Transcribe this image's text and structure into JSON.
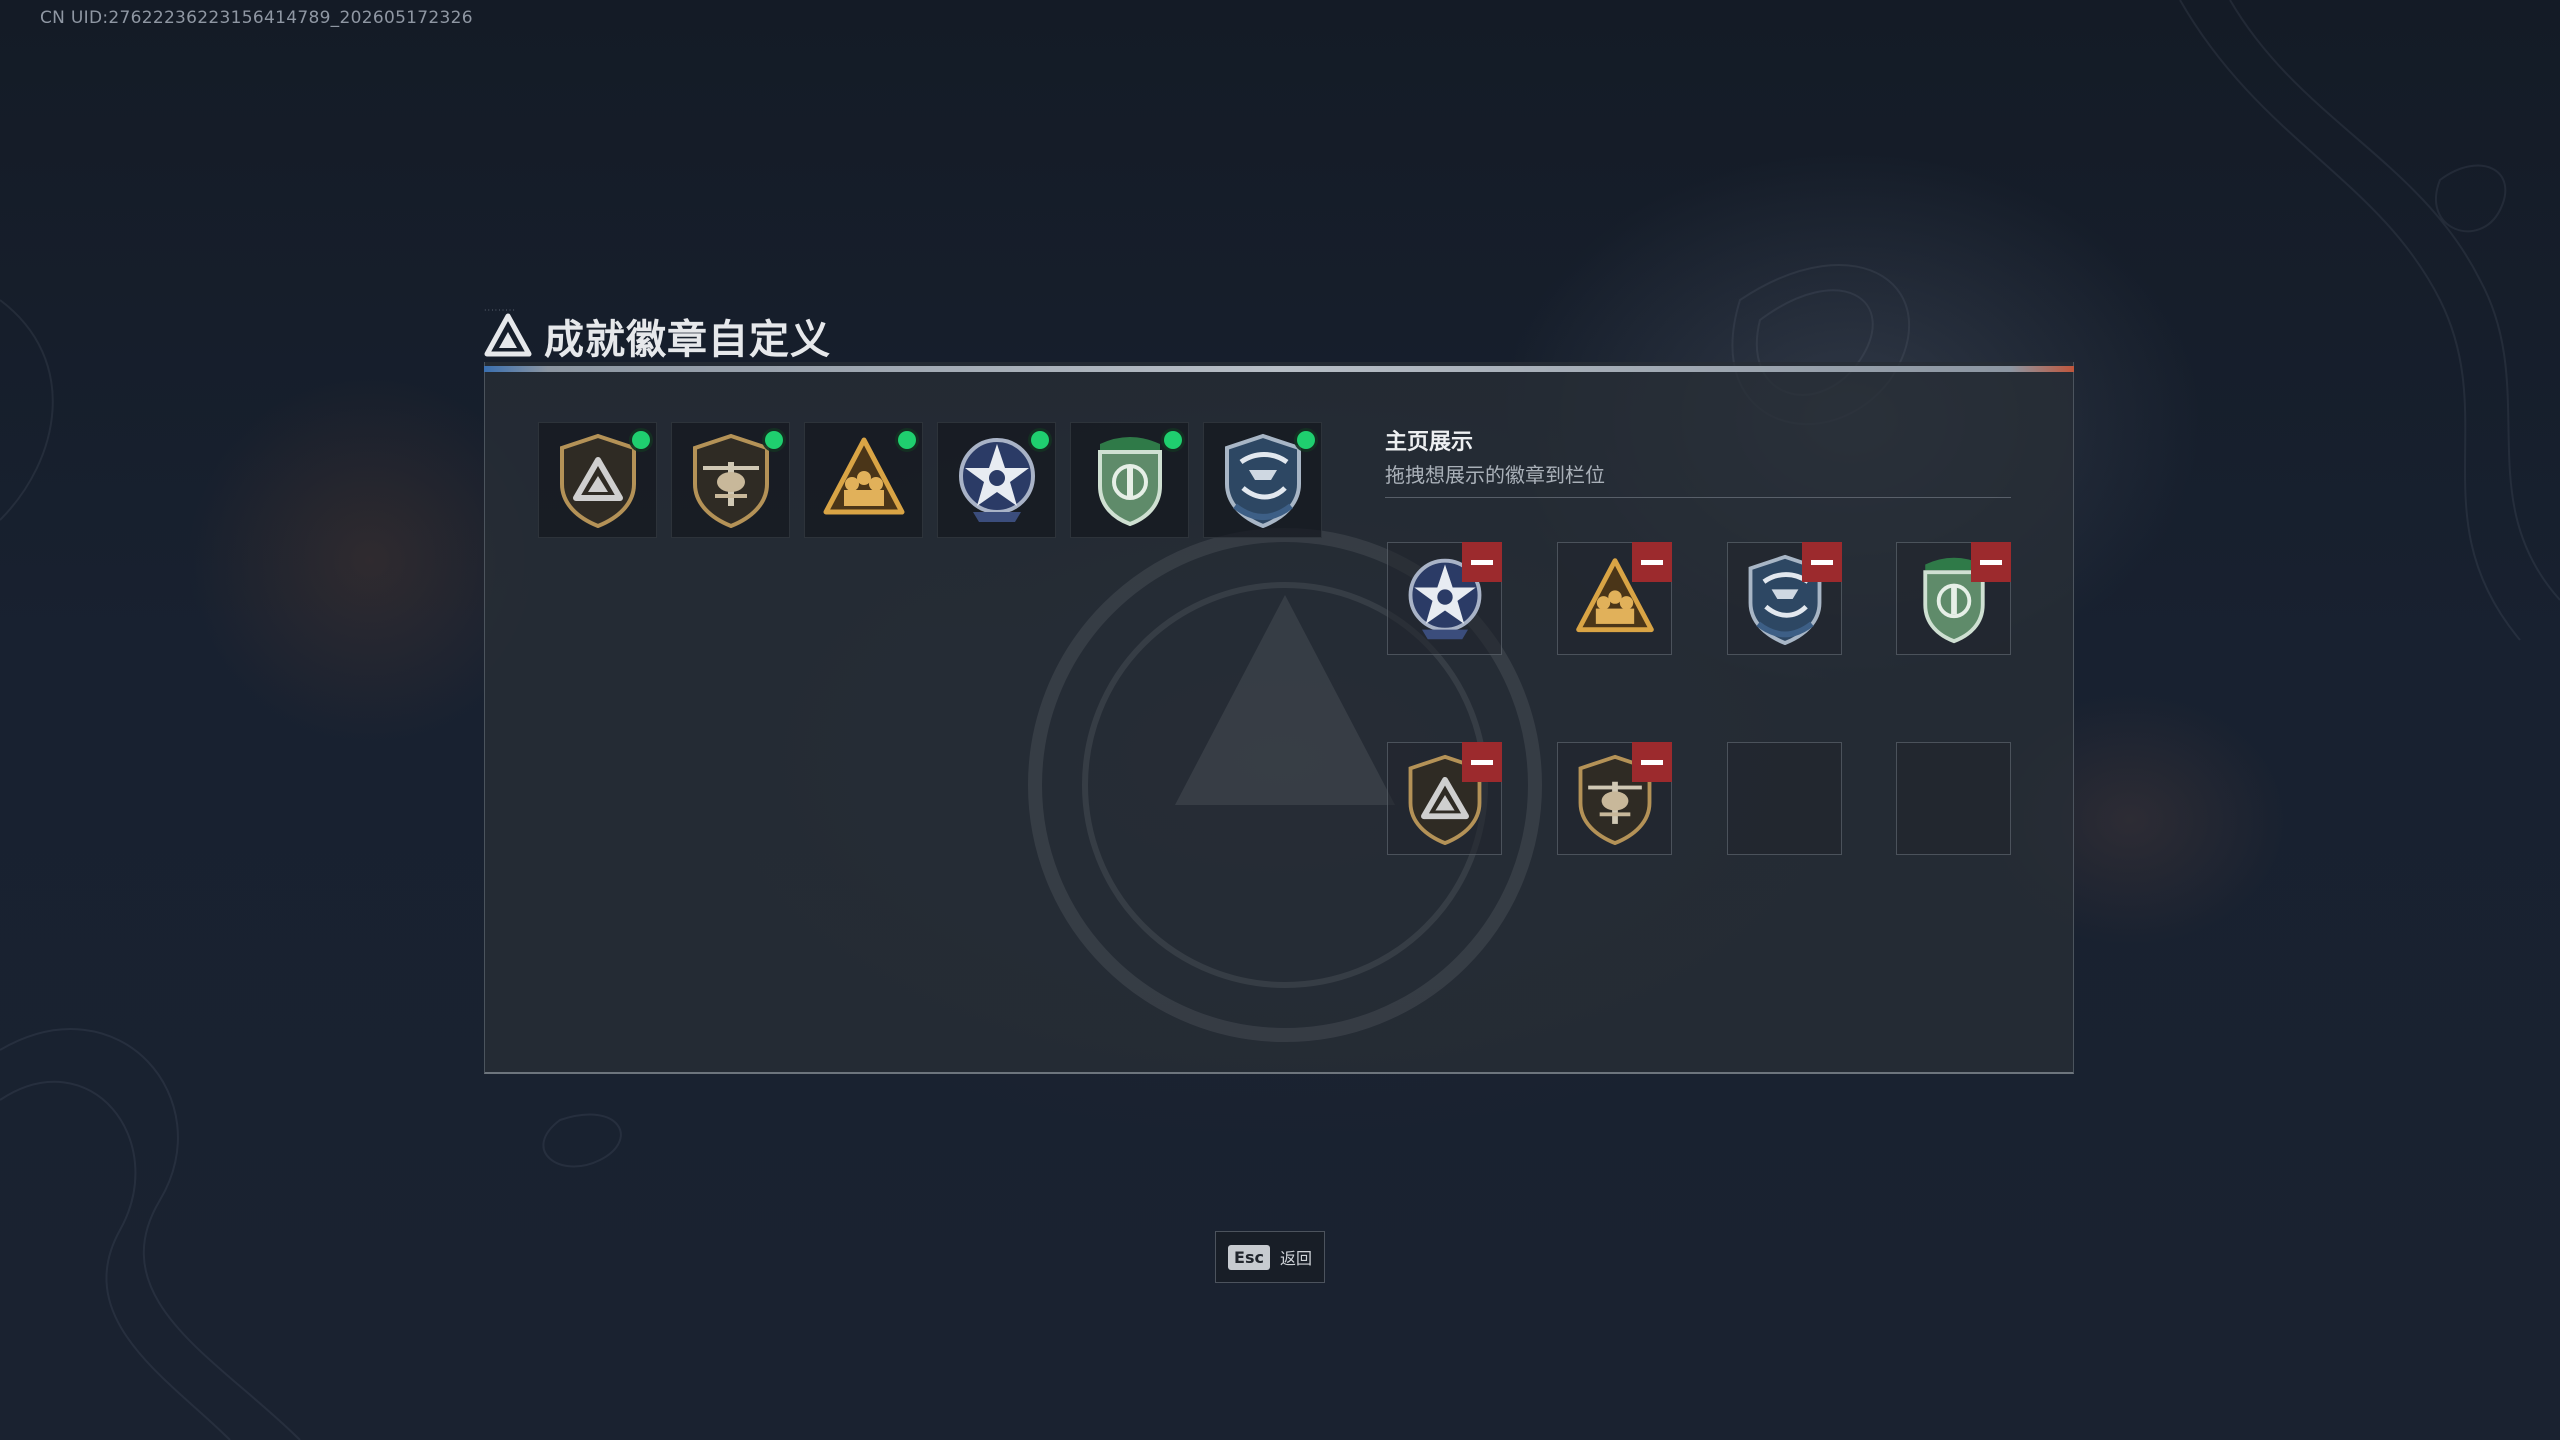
{
  "uid": "CN UID:2762223622315641478­9_202605172326",
  "page": {
    "title": "成就徽章自定义",
    "title_icon": "delta-logo-icon"
  },
  "owned_badges": [
    {
      "name": "delta-badge",
      "equipped": true
    },
    {
      "name": "helicopter-badge",
      "equipped": true
    },
    {
      "name": "squad-badge",
      "equipped": true
    },
    {
      "name": "star-badge",
      "equipped": true
    },
    {
      "name": "green-shield-badge",
      "equipped": true
    },
    {
      "name": "blue-eagle-badge",
      "equipped": true
    }
  ],
  "showcase": {
    "title": "主页展示",
    "subtitle": "拖拽想展示的徽章到栏位",
    "slots": [
      {
        "badge": "star-badge"
      },
      {
        "badge": "squad-badge"
      },
      {
        "badge": "blue-eagle-badge"
      },
      {
        "badge": "green-shield-badge"
      },
      {
        "badge": "delta-badge"
      },
      {
        "badge": "helicopter-badge"
      },
      {
        "badge": null
      },
      {
        "badge": null
      }
    ]
  },
  "footer": {
    "esc_key": "Esc",
    "back_label": "返回"
  },
  "colors": {
    "equipped": "#1fcf6f",
    "remove": "#9c2a2d",
    "gold": "#c9a25a",
    "background": "#182130"
  }
}
